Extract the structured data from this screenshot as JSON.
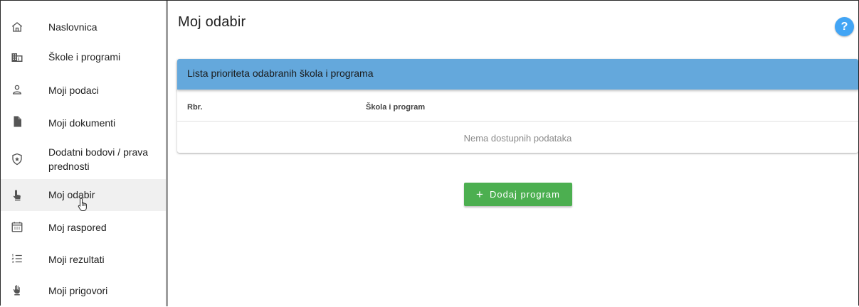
{
  "sidebar": {
    "items": [
      {
        "label": "Naslovnica",
        "icon": "home-icon"
      },
      {
        "label": "Škole i programi",
        "icon": "building-icon"
      },
      {
        "label": "Moji podaci",
        "icon": "person-icon"
      },
      {
        "label": "Moji dokumenti",
        "icon": "document-icon"
      },
      {
        "label": "Dodatni bodovi / prava prednosti",
        "icon": "shield-star-icon"
      },
      {
        "label": "Moj odabir",
        "icon": "touch-icon",
        "active": true
      },
      {
        "label": "Moj raspored",
        "icon": "calendar-icon"
      },
      {
        "label": "Moji rezultati",
        "icon": "list-numbered-icon"
      },
      {
        "label": "Moji prigovori",
        "icon": "hand-icon"
      }
    ]
  },
  "main": {
    "title": "Moj odabir",
    "help_label": "?",
    "card": {
      "title": "Lista prioriteta odabranih škola i programa",
      "columns": [
        "Rbr.",
        "Škola i program"
      ],
      "empty_text": "Nema dostupnih podataka"
    },
    "add_button": {
      "icon": "+",
      "label": "Dodaj program"
    }
  },
  "colors": {
    "card_header": "#64a8dc",
    "add_button": "#4caf50",
    "help_button": "#42a5f5"
  }
}
